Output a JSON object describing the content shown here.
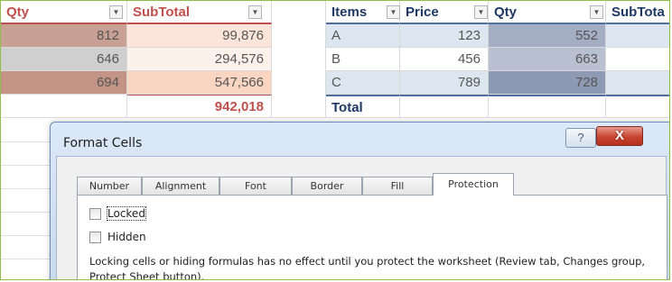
{
  "left_table": {
    "headers": {
      "qty": "Qty",
      "subtotal": "SubTotal"
    },
    "rows": [
      {
        "qty": "812",
        "subtotal": "99,876"
      },
      {
        "qty": "646",
        "subtotal": "294,576"
      },
      {
        "qty": "694",
        "subtotal": "547,566"
      }
    ],
    "total": "942,018"
  },
  "right_table": {
    "headers": {
      "items": "Items",
      "price": "Price",
      "qty": "Qty",
      "subtotal": "SubTota"
    },
    "rows": [
      {
        "item": "A",
        "price": "123",
        "qty": "552"
      },
      {
        "item": "B",
        "price": "456",
        "qty": "663"
      },
      {
        "item": "C",
        "price": "789",
        "qty": "728"
      }
    ],
    "total_label": "Total"
  },
  "dialog": {
    "title": "Format Cells",
    "help_glyph": "?",
    "close_glyph": "X",
    "tabs": [
      {
        "label": "Number"
      },
      {
        "label": "Alignment"
      },
      {
        "label": "Font"
      },
      {
        "label": "Border"
      },
      {
        "label": "Fill"
      },
      {
        "label": "Protection"
      }
    ],
    "active_tab": "Protection",
    "locked_label": "Locked",
    "locked_checked": false,
    "hidden_label": "Hidden",
    "hidden_checked": false,
    "note": "Locking cells or hiding formulas has no effect until you protect the worksheet (Review tab, Changes group, Protect Sheet button)."
  },
  "colors": {
    "heat_dark": "#c69b90",
    "heat_light": "#f6d7c9",
    "band_blue": "#dce6f1",
    "qty_blue": "#9aa5be",
    "close_red": "#c7442f"
  }
}
